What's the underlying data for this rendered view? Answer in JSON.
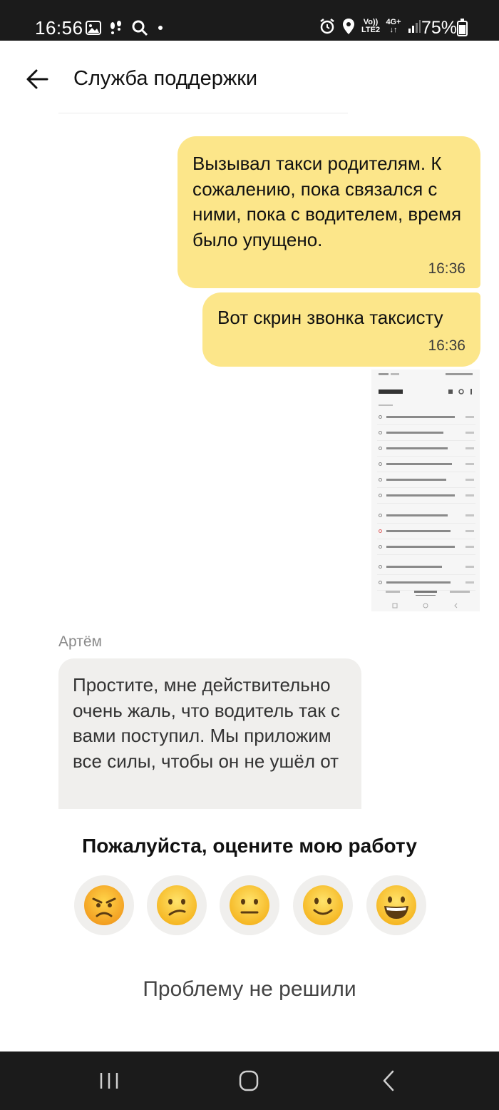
{
  "status_bar": {
    "time": "16:56",
    "battery": "75%",
    "battery_level": 0.75,
    "network_top": "Vo))",
    "network_bottom": "LTE2",
    "network_type": "4G+",
    "icons": [
      "image-icon",
      "steps-icon",
      "search-icon",
      "dot-icon",
      "alarm-icon",
      "location-icon",
      "volte-icon",
      "4g-icon",
      "signal-icon",
      "battery-icon"
    ]
  },
  "header": {
    "title": "Служба поддержки"
  },
  "messages": {
    "outgoing": [
      {
        "text": "Вызывал такси родителям. К сожалению, пока связался с ними, пока с водителем, время было упущено.",
        "time": "16:36"
      },
      {
        "text": "Вот скрин звонка таксисту",
        "time": "16:36"
      }
    ],
    "incoming": {
      "sender": "Артём",
      "text": "Простите, мне действительно очень жаль, что водитель так с вами поступил. Мы приложим все силы, чтобы он не ушёл от"
    }
  },
  "rating": {
    "title": "Пожалуйста, оцените мою работу",
    "options": [
      "angry-emoji-icon",
      "sad-emoji-icon",
      "neutral-emoji-icon",
      "smile-emoji-icon",
      "grin-emoji-icon"
    ],
    "unsolved_label": "Проблему не решили"
  },
  "colors": {
    "outgoing_bubble": "#fce68a",
    "incoming_bubble": "#f0efed",
    "status_bar": "#1b1b1b",
    "emoji_yellow": "#f8c52c"
  }
}
